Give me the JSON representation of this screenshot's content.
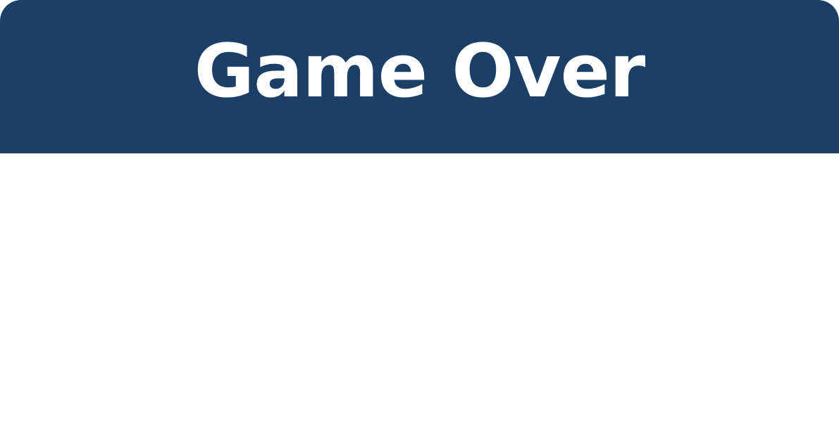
{
  "dialog": {
    "title": "Game Over"
  },
  "colors": {
    "header_background": "#1b3f66",
    "title_text": "#ffffff",
    "body_background": "#ffffff"
  }
}
